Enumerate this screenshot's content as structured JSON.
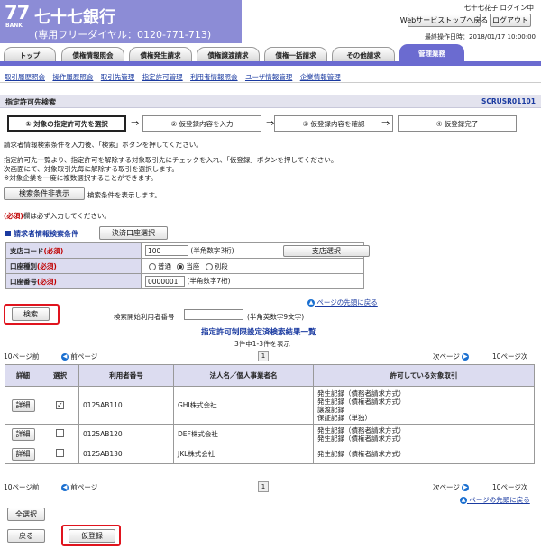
{
  "header": {
    "logo_number": "77",
    "logo_bank": "BANK",
    "bank_name": "七十七銀行",
    "freedial": "(専用フリーダイヤル：0120-771-713)",
    "user_status": "七十七花子 ログイン中",
    "web_service_top": "Webサービストップへ戻る",
    "logout": "ログアウト",
    "last_operation": "最終操作日時：2018/01/17 10:00:00"
  },
  "tabs": [
    "トップ",
    "債権情報照会",
    "債権発生請求",
    "債権譲渡請求",
    "債権一括請求",
    "その他請求",
    "管理業務"
  ],
  "subnav": [
    "取引履歴照会",
    "操作履歴照会",
    "取引先管理",
    "指定許可管理",
    "利用者情報照会",
    "ユーザ情報管理",
    "企業情報管理"
  ],
  "page": {
    "title": "指定許可先検索",
    "code": "SCRUSR01101"
  },
  "steps": [
    "① 対象の指定許可先を選択",
    "② 仮登録内容を入力",
    "③ 仮登録内容を確認",
    "④ 仮登録完了"
  ],
  "step_arrow": "⇒",
  "instructions": {
    "line1": "請求者情報検索条件を入力後、「検索」ボタンを押してください。",
    "line2": "指定許可先一覧より、指定許可を解除する対象取引先にチェックを入れ、「仮登録」ボタンを押してください。",
    "line3": "次画面にて、対象取引先毎に解除する取引を選択します。",
    "line4": "※対象企業を一度に複数選択することができます。"
  },
  "search_toggle": {
    "button": "検索条件非表示",
    "note": "検索条件を表示します。"
  },
  "required_note": {
    "mark": "(必須)",
    "text": "欄は必ず入力してください。"
  },
  "search_section": {
    "title": "請求者情報検索条件",
    "settlement_button": "決済口座選択",
    "branch_label": "支店コード",
    "branch_required": "(必須)",
    "branch_value": "100",
    "branch_hint": "(半角数字3桁)",
    "branch_button": "支店選択",
    "account_type_label": "口座種別",
    "account_type_required": "(必須)",
    "account_type_options": [
      "普通",
      "当座",
      "別段"
    ],
    "account_type_selected": "当座",
    "account_no_label": "口座番号",
    "account_no_required": "(必須)",
    "account_no_value": "0000001",
    "account_no_hint": "(半角数字7桁)"
  },
  "page_top_link": "ページの先頭に戻る",
  "search_button": "検索",
  "search_user_no_label": "検索開始利用者番号",
  "search_user_no_hint": "(半角英数字9文字)",
  "results": {
    "title": "指定許可制限設定済検索結果一覧",
    "count_text": "3件中1-3件を表示",
    "prev10": "10ページ前",
    "prev": "前ページ",
    "next": "次ページ",
    "next10": "10ページ次",
    "page_number": "1",
    "headers": [
      "詳細",
      "選択",
      "利用者番号",
      "法人名／個人事業者名",
      "許可している対象取引"
    ],
    "detail_label": "詳細",
    "rows": [
      {
        "checked": true,
        "user_no": "0125AB110",
        "name": "GHI株式会社",
        "permissions": [
          "発生記録（債務者請求方式）",
          "発生記録（債権者請求方式）",
          "譲渡記録",
          "保証記録（単独）"
        ]
      },
      {
        "checked": false,
        "user_no": "0125AB120",
        "name": "DEF株式会社",
        "permissions": [
          "発生記録（債務者請求方式）",
          "発生記録（債権者請求方式）"
        ]
      },
      {
        "checked": false,
        "user_no": "0125AB130",
        "name": "JKL株式会社",
        "permissions": [
          "発生記録（債権者請求方式）"
        ]
      }
    ]
  },
  "select_all_button": "全選択",
  "back_button": "戻る",
  "register_button": "仮登録",
  "colors": {
    "header_purple": "#8c8cd6",
    "tab_active": "#6b6bd0",
    "highlight_red": "#e0141e",
    "label_bg": "#dcdcf0"
  }
}
